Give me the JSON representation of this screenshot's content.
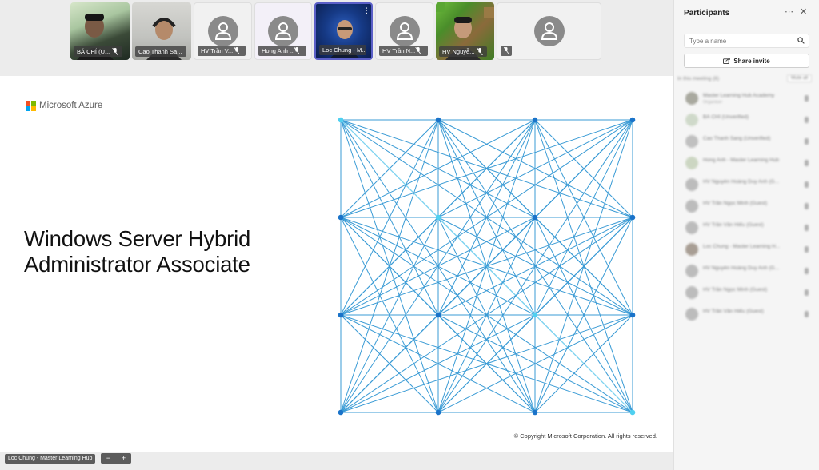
{
  "colors": {
    "accent": "#5b5fc7",
    "mesh_line": "#3a9bd5",
    "mesh_line_light": "#7fd3f0",
    "node": "#1a73c9",
    "node_light": "#4fd0f0"
  },
  "video_tiles": [
    {
      "name": "BÁ CHÍ (U...",
      "type": "video",
      "muted": true
    },
    {
      "name": "Cao Thanh Sa...",
      "type": "video",
      "muted": false
    },
    {
      "name": "HV Trần V...",
      "type": "avatar",
      "muted": true,
      "icon": "person-icon"
    },
    {
      "name": "Hong Anh ...",
      "type": "avatar",
      "muted": true,
      "icon": "person-icon"
    },
    {
      "name": "Loc Chung - M...",
      "type": "video",
      "muted": false,
      "active": true
    },
    {
      "name": "HV Trần N...",
      "type": "avatar",
      "muted": true,
      "icon": "person-icon"
    },
    {
      "name": "HV Nguyễ...",
      "type": "video",
      "muted": true
    },
    {
      "name": "",
      "type": "avatar",
      "muted": true,
      "icon": "person-icon"
    }
  ],
  "slide": {
    "brand": "Microsoft Azure",
    "logo_colors": [
      "#f25022",
      "#7fba00",
      "#00a4ef",
      "#ffb900"
    ],
    "title_line1": "Windows Server Hybrid",
    "title_line2": "Administrator Associate",
    "copyright": "© Copyright Microsoft Corporation. All rights reserved."
  },
  "presenter": {
    "label": "Loc Chung - Master Learning Hub",
    "zoom_out": "−",
    "zoom_in": "+"
  },
  "panel": {
    "title": "Participants",
    "more_icon": "more-options-icon",
    "close_icon": "close-icon",
    "search_placeholder": "Type a name",
    "share_label": "Share invite",
    "in_meeting_label": "In this meeting (8)",
    "mute_all_label": "Mute all",
    "participants": [
      {
        "name": "Master Learning Hub Academy",
        "sub": "Organiser",
        "muted": true
      },
      {
        "name": "BÁ CHÍ (Unverified)",
        "sub": "",
        "muted": true
      },
      {
        "name": "Cao Thanh Sang (Unverified)",
        "sub": "",
        "muted": false
      },
      {
        "name": "Hong Anh - Master Learning Hub",
        "sub": "",
        "muted": true
      },
      {
        "name": "HV Nguyễn Hoàng Duy Anh (G...",
        "sub": "",
        "muted": true
      },
      {
        "name": "HV Trần Ngọc Minh (Guest)",
        "sub": "",
        "muted": true
      },
      {
        "name": "HV Trần Văn Hiếu (Guest)",
        "sub": "",
        "muted": true
      },
      {
        "name": "Loc Chung - Master Learning H...",
        "sub": "",
        "muted": false
      },
      {
        "name": "HV Nguyễn Hoàng Duy Anh (G...",
        "sub": "",
        "muted": true
      },
      {
        "name": "HV Trần Ngọc Minh (Guest)",
        "sub": "",
        "muted": true
      },
      {
        "name": "HV Trần Văn Hiếu (Guest)",
        "sub": "",
        "muted": true
      }
    ]
  }
}
